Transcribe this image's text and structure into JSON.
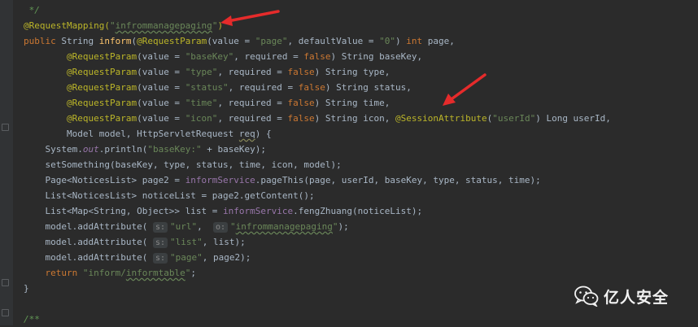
{
  "editor": {
    "lines": [
      {
        "id": "l0",
        "tokens": [
          {
            "t": " */",
            "c": "cmt"
          }
        ]
      },
      {
        "id": "l1",
        "tokens": [
          {
            "t": "@RequestMapping(",
            "c": "ann"
          },
          {
            "t": "\"",
            "c": "str"
          },
          {
            "t": "infrommanagepaging",
            "c": "str typo"
          },
          {
            "t": "\"",
            "c": "str"
          },
          {
            "t": ")",
            "c": "ann"
          }
        ]
      },
      {
        "id": "l2",
        "tokens": [
          {
            "t": "public ",
            "c": "kw"
          },
          {
            "t": "String ",
            "c": ""
          },
          {
            "t": "inform",
            "c": "fn"
          },
          {
            "t": "(",
            "c": ""
          },
          {
            "t": "@RequestParam",
            "c": "ann"
          },
          {
            "t": "(value = ",
            "c": ""
          },
          {
            "t": "\"page\"",
            "c": "str"
          },
          {
            "t": ", defaultValue = ",
            "c": ""
          },
          {
            "t": "\"0\"",
            "c": "str"
          },
          {
            "t": ") ",
            "c": ""
          },
          {
            "t": "int ",
            "c": "kw"
          },
          {
            "t": "page,",
            "c": ""
          }
        ]
      },
      {
        "id": "l3",
        "tokens": [
          {
            "t": "        ",
            "c": ""
          },
          {
            "t": "@RequestParam",
            "c": "ann"
          },
          {
            "t": "(value = ",
            "c": ""
          },
          {
            "t": "\"baseKey\"",
            "c": "str"
          },
          {
            "t": ", required = ",
            "c": ""
          },
          {
            "t": "false",
            "c": "kw"
          },
          {
            "t": ") String baseKey,",
            "c": ""
          }
        ]
      },
      {
        "id": "l4",
        "tokens": [
          {
            "t": "        ",
            "c": ""
          },
          {
            "t": "@RequestParam",
            "c": "ann"
          },
          {
            "t": "(value = ",
            "c": ""
          },
          {
            "t": "\"type\"",
            "c": "str"
          },
          {
            "t": ", required = ",
            "c": ""
          },
          {
            "t": "false",
            "c": "kw"
          },
          {
            "t": ") String type,",
            "c": ""
          }
        ]
      },
      {
        "id": "l5",
        "tokens": [
          {
            "t": "        ",
            "c": ""
          },
          {
            "t": "@RequestParam",
            "c": "ann"
          },
          {
            "t": "(value = ",
            "c": ""
          },
          {
            "t": "\"status\"",
            "c": "str"
          },
          {
            "t": ", required = ",
            "c": ""
          },
          {
            "t": "false",
            "c": "kw"
          },
          {
            "t": ") String status,",
            "c": ""
          }
        ]
      },
      {
        "id": "l6",
        "tokens": [
          {
            "t": "        ",
            "c": ""
          },
          {
            "t": "@RequestParam",
            "c": "ann"
          },
          {
            "t": "(value = ",
            "c": ""
          },
          {
            "t": "\"time\"",
            "c": "str"
          },
          {
            "t": ", required = ",
            "c": ""
          },
          {
            "t": "false",
            "c": "kw"
          },
          {
            "t": ") String time,",
            "c": ""
          }
        ]
      },
      {
        "id": "l7",
        "tokens": [
          {
            "t": "        ",
            "c": ""
          },
          {
            "t": "@RequestParam",
            "c": "ann"
          },
          {
            "t": "(value = ",
            "c": ""
          },
          {
            "t": "\"icon\"",
            "c": "str"
          },
          {
            "t": ", required = ",
            "c": ""
          },
          {
            "t": "false",
            "c": "kw"
          },
          {
            "t": ") String icon, ",
            "c": ""
          },
          {
            "t": "@SessionAttribute",
            "c": "ann"
          },
          {
            "t": "(",
            "c": ""
          },
          {
            "t": "\"userId\"",
            "c": "str"
          },
          {
            "t": ") Long userId,",
            "c": ""
          }
        ]
      },
      {
        "id": "l8",
        "tokens": [
          {
            "t": "        Model model, HttpServletRequest ",
            "c": ""
          },
          {
            "t": "req",
            "c": "warn"
          },
          {
            "t": ") {",
            "c": ""
          }
        ]
      },
      {
        "id": "l9",
        "tokens": [
          {
            "t": "    System.",
            "c": ""
          },
          {
            "t": "out",
            "c": "fld"
          },
          {
            "t": ".println(",
            "c": ""
          },
          {
            "t": "\"baseKey:\"",
            "c": "str"
          },
          {
            "t": " + baseKey);",
            "c": ""
          }
        ]
      },
      {
        "id": "l10",
        "tokens": [
          {
            "t": "    setSomething(baseKey, type, status, time, icon, model);",
            "c": ""
          }
        ]
      },
      {
        "id": "l11",
        "tokens": [
          {
            "t": "    Page<NoticesList> page2 = ",
            "c": ""
          },
          {
            "t": "informService",
            "c": "svc"
          },
          {
            "t": ".pageThis(page, userId, baseKey, type, status, time);",
            "c": ""
          }
        ]
      },
      {
        "id": "l12",
        "tokens": [
          {
            "t": "    List<NoticesList> noticeList = page2.getContent();",
            "c": ""
          }
        ]
      },
      {
        "id": "l13",
        "tokens": [
          {
            "t": "    List<Map<String, Object>> list = ",
            "c": ""
          },
          {
            "t": "informService",
            "c": "svc"
          },
          {
            "t": ".fengZhuang(noticeList);",
            "c": ""
          }
        ]
      },
      {
        "id": "l14",
        "tokens": [
          {
            "t": "    model.addAttribute( ",
            "c": ""
          },
          {
            "t": "s:",
            "c": "hint"
          },
          {
            "t": "\"url\"",
            "c": "str"
          },
          {
            "t": ",  ",
            "c": ""
          },
          {
            "t": "o:",
            "c": "hint"
          },
          {
            "t": "\"",
            "c": "str"
          },
          {
            "t": "infrommanagepaging",
            "c": "str typo"
          },
          {
            "t": "\"",
            "c": "str"
          },
          {
            "t": ");",
            "c": ""
          }
        ]
      },
      {
        "id": "l15",
        "tokens": [
          {
            "t": "    model.addAttribute( ",
            "c": ""
          },
          {
            "t": "s:",
            "c": "hint"
          },
          {
            "t": "\"list\"",
            "c": "str"
          },
          {
            "t": ", list);",
            "c": ""
          }
        ]
      },
      {
        "id": "l16",
        "tokens": [
          {
            "t": "    model.addAttribute( ",
            "c": ""
          },
          {
            "t": "s:",
            "c": "hint"
          },
          {
            "t": "\"page\"",
            "c": "str"
          },
          {
            "t": ", page2);",
            "c": ""
          }
        ]
      },
      {
        "id": "l17",
        "tokens": [
          {
            "t": "    ",
            "c": ""
          },
          {
            "t": "return ",
            "c": "kw"
          },
          {
            "t": "\"inform/",
            "c": "str"
          },
          {
            "t": "informtable",
            "c": "str typo"
          },
          {
            "t": "\"",
            "c": "str"
          },
          {
            "t": ";",
            "c": ""
          }
        ]
      },
      {
        "id": "l18",
        "tokens": [
          {
            "t": "}",
            "c": ""
          }
        ]
      },
      {
        "id": "l19",
        "tokens": [
          {
            "t": "",
            "c": ""
          }
        ]
      },
      {
        "id": "l20",
        "tokens": [
          {
            "t": "/**",
            "c": "cmt"
          }
        ]
      }
    ]
  },
  "watermark": {
    "text": "亿人安全",
    "icon": "wechat-icon"
  },
  "colors": {
    "arrow": "#e52b2b"
  }
}
